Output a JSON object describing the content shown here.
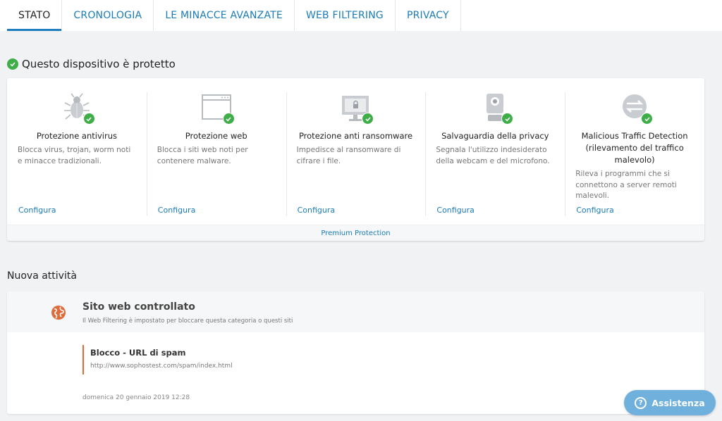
{
  "tabs": [
    {
      "label": "STATO",
      "active": true
    },
    {
      "label": "CRONOLOGIA"
    },
    {
      "label": "LE MINACCE AVANZATE"
    },
    {
      "label": "WEB FILTERING"
    },
    {
      "label": "PRIVACY"
    }
  ],
  "status": {
    "title": "Questo dispositivo è protetto",
    "icon": "check-circle-icon",
    "color": "#3fae49"
  },
  "features": [
    {
      "icon": "bug-icon",
      "title": "Protezione antivirus",
      "desc": "Blocca virus, trojan, worm noti e minacce tradizionali.",
      "link": "Configura"
    },
    {
      "icon": "browser-window-icon",
      "title": "Protezione web",
      "desc": "Blocca i siti web noti per contenere malware.",
      "link": "Configura"
    },
    {
      "icon": "monitor-lock-icon",
      "title": "Protezione anti ransomware",
      "desc": "Impedisce al ransomware di cifrare i file.",
      "link": "Configura"
    },
    {
      "icon": "webcam-icon",
      "title": "Salvaguardia della privacy",
      "desc": "Segnala l'utilizzo indesiderato della webcam e del microfono.",
      "link": "Configura"
    },
    {
      "icon": "traffic-icon",
      "title": "Malicious Traffic Detection (rilevamento del traffico malevolo)",
      "desc": "Rileva i programmi che si connettono a server remoti malevoli.",
      "link": "Configura"
    }
  ],
  "features_footer": "Premium Protection",
  "activity": {
    "section_title": "Nuova attività",
    "icon": "globe-icon",
    "accent": "#e06b3a",
    "title": "Sito web controllato",
    "subtitle": "Il Web Filtering è impostato per bloccare questa categoria o questi siti",
    "block_title": "Blocco - URL di spam",
    "block_url": "http://www.sophostest.com/spam/index.html",
    "date": "domenica 20 gennaio 2019 12:28"
  },
  "help": {
    "label": "Assistenza",
    "icon": "question-icon"
  },
  "colors": {
    "link": "#1a7bb8",
    "success": "#3fae49",
    "help_button": "#6fb0dc"
  }
}
